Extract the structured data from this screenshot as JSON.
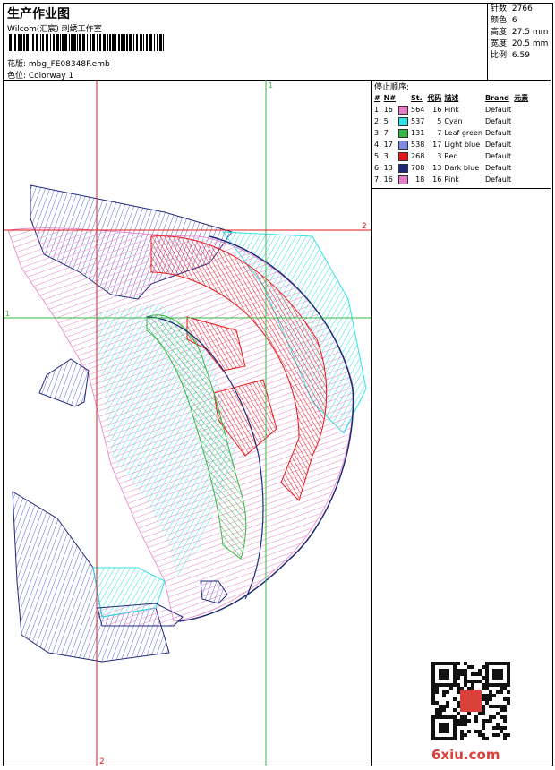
{
  "header": {
    "title": "生产作业图",
    "subtitle": "Wilcom(汇宸) 刺绣工作室",
    "design": "花版:  mbg_FE08348F.emb",
    "colorway": "色位:  Colorway 1"
  },
  "stats": [
    {
      "label": "针数:",
      "value": "2766"
    },
    {
      "label": "颜色:",
      "value": "6"
    },
    {
      "label": "高度:",
      "value": "27.5 mm"
    },
    {
      "label": "宽度:",
      "value": "20.5 mm"
    },
    {
      "label": "比例:",
      "value": "6.59"
    }
  ],
  "stop_sequence": {
    "title": "停止顺序:",
    "headers": [
      "#",
      "N#",
      "St.",
      "代码",
      "描述",
      "Brand",
      "元素"
    ],
    "rows": [
      {
        "n": "1.",
        "needle": "16",
        "color": "#e87fc6",
        "stitches": "564",
        "code": "16",
        "desc": "Pink",
        "brand": "Default"
      },
      {
        "n": "2.",
        "needle": "5",
        "color": "#31e2e5",
        "stitches": "537",
        "code": "5",
        "desc": "Cyan",
        "brand": "Default"
      },
      {
        "n": "3.",
        "needle": "7",
        "color": "#37b844",
        "stitches": "131",
        "code": "7",
        "desc": "Leaf green",
        "brand": "Default"
      },
      {
        "n": "4.",
        "needle": "17",
        "color": "#7f8be3",
        "stitches": "538",
        "code": "17",
        "desc": "Light blue",
        "brand": "Default"
      },
      {
        "n": "5.",
        "needle": "3",
        "color": "#e31919",
        "stitches": "268",
        "code": "3",
        "desc": "Red",
        "brand": "Default"
      },
      {
        "n": "6.",
        "needle": "13",
        "color": "#1e2a77",
        "stitches": "708",
        "code": "13",
        "desc": "Dark blue",
        "brand": "Default"
      },
      {
        "n": "7.",
        "needle": "16",
        "color": "#e87fc6",
        "stitches": "18",
        "code": "16",
        "desc": "Pink",
        "brand": "Default"
      }
    ]
  },
  "guides": {
    "v1": "1",
    "v2": "2",
    "h1": "1",
    "h2": "2",
    "bottom": "2"
  },
  "watermark": "6xiu.com"
}
